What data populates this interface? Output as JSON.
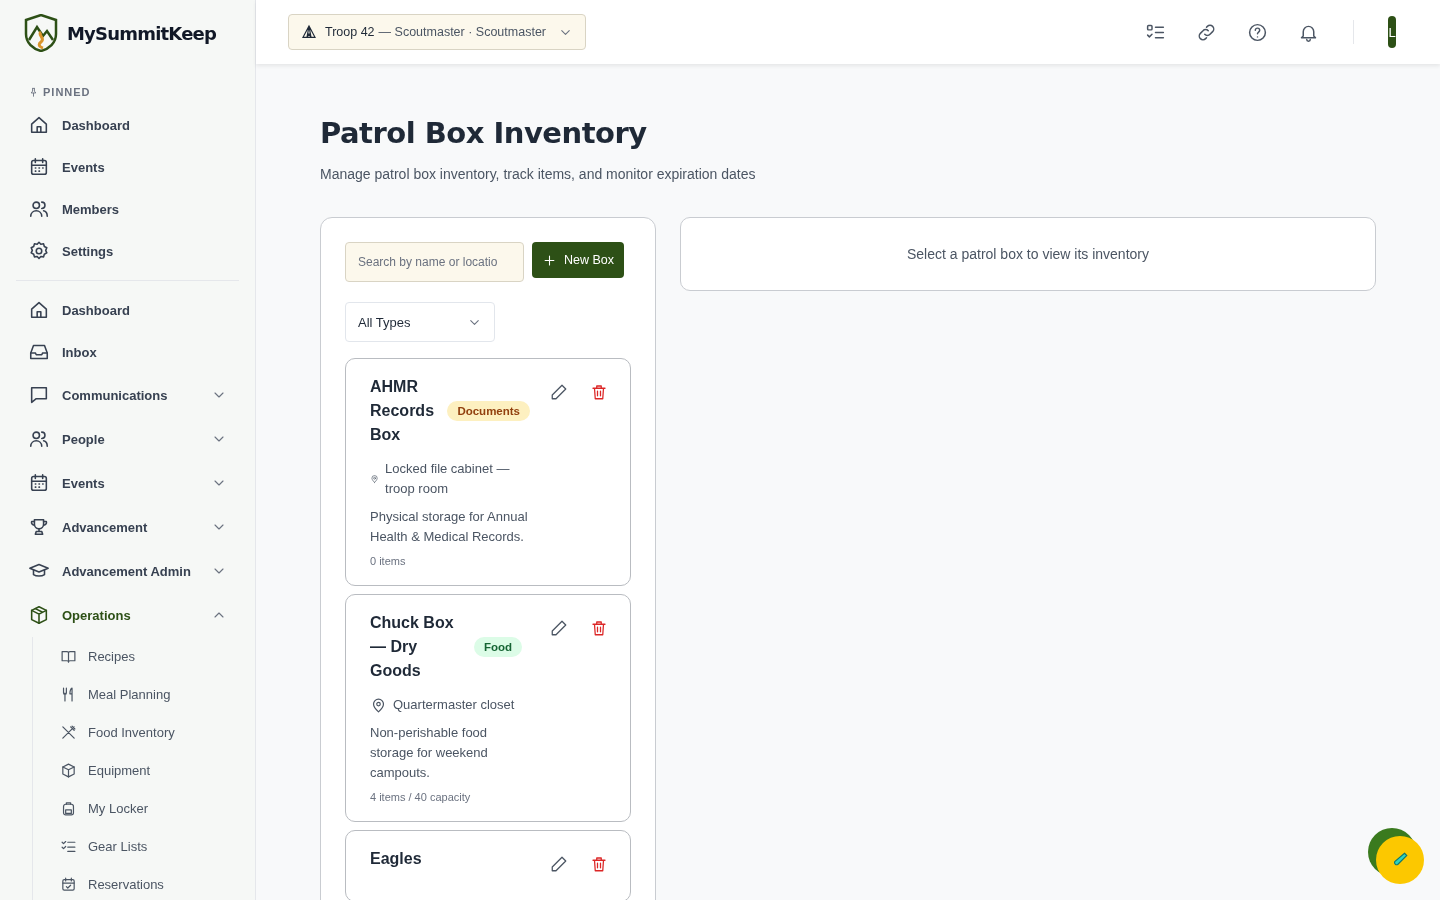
{
  "brand": {
    "name": "MySummitKeep"
  },
  "context_switcher": {
    "troop": "Troop 42",
    "role": "— Scoutmaster · Scoutmaster"
  },
  "user": {
    "initial": "L"
  },
  "sidebar": {
    "pinned_label": "PINNED",
    "pinned": [
      {
        "label": "Dashboard"
      },
      {
        "label": "Events"
      },
      {
        "label": "Members"
      },
      {
        "label": "Settings"
      }
    ],
    "items": [
      {
        "label": "Dashboard",
        "kind": "link"
      },
      {
        "label": "Inbox",
        "kind": "link"
      },
      {
        "label": "Communications",
        "kind": "group",
        "expanded": false
      },
      {
        "label": "People",
        "kind": "group",
        "expanded": false
      },
      {
        "label": "Events",
        "kind": "group",
        "expanded": false
      },
      {
        "label": "Advancement",
        "kind": "group",
        "expanded": false
      },
      {
        "label": "Advancement Admin",
        "kind": "group",
        "expanded": false
      },
      {
        "label": "Operations",
        "kind": "group",
        "expanded": true,
        "children": [
          {
            "label": "Recipes"
          },
          {
            "label": "Meal Planning"
          },
          {
            "label": "Food Inventory"
          },
          {
            "label": "Equipment"
          },
          {
            "label": "My Locker"
          },
          {
            "label": "Gear Lists"
          },
          {
            "label": "Reservations"
          }
        ]
      }
    ]
  },
  "page": {
    "title": "Patrol Box Inventory",
    "subtitle": "Manage patrol box inventory, track items, and monitor expiration dates"
  },
  "toolbar": {
    "search_placeholder": "Search by name or locatio",
    "new_button": "New Box",
    "type_filter": "All Types"
  },
  "boxes": [
    {
      "name": "AHMR Records Box",
      "type": "Documents",
      "color": "#fdf0c0",
      "location": "Locked file cabinet — troop room",
      "description": "Physical storage for Annual Health & Medical Records.",
      "count": "0 items"
    },
    {
      "name": "Chuck Box — Dry Goods",
      "type": "Food",
      "color": "#dcfce7",
      "location": "Quartermaster closet",
      "description": "Non-perishable food storage for weekend campouts.",
      "count": "4 items / 40 capacity"
    },
    {
      "name": "Eagles"
    }
  ],
  "detail": {
    "empty_message": "Select a patrol box to view its inventory"
  }
}
